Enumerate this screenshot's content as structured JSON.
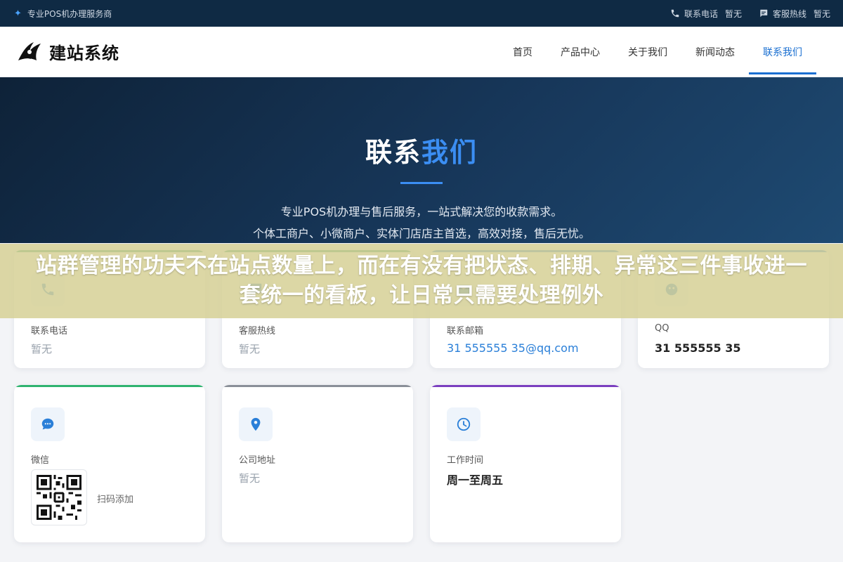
{
  "topbar": {
    "tagline": "专业POS机办理服务商",
    "phone_label": "联系电话",
    "phone_value": "暂无",
    "hotline_label": "客服热线",
    "hotline_value": "暂无"
  },
  "header": {
    "logo_text": "建站系统",
    "nav": [
      {
        "label": "首页",
        "active": false
      },
      {
        "label": "产品中心",
        "active": false
      },
      {
        "label": "关于我们",
        "active": false
      },
      {
        "label": "新闻动态",
        "active": false
      },
      {
        "label": "联系我们",
        "active": true
      }
    ]
  },
  "hero": {
    "title_plain": "联系",
    "title_highlight": "我们",
    "desc_line1": "专业POS机办理与售后服务，一站式解决您的收款需求。",
    "desc_line2": "个体工商户、小微商户、实体门店店主首选，高效对接，售后无忧。"
  },
  "cards": [
    {
      "label": "联系电话",
      "value": "暂无",
      "icon": "phone-icon",
      "accent": "#2f9e6a"
    },
    {
      "label": "客服热线",
      "value": "暂无",
      "icon": "chat-icon",
      "accent": "#2f9e6a"
    },
    {
      "label": "联系邮箱",
      "value": "31 555555 35@qq.com",
      "icon": "mail-icon",
      "accent": "#2a7fd8"
    },
    {
      "label": "QQ",
      "value": "31 555555 35",
      "icon": "qq-icon",
      "accent": "#2a7fd8"
    },
    {
      "label": "微信",
      "qr_text": "扫码添加",
      "icon": "wechat-icon",
      "accent": "#2fb36f"
    },
    {
      "label": "公司地址",
      "value": "暂无",
      "icon": "location-icon",
      "accent": "#8a8f98"
    },
    {
      "label": "工作时间",
      "value": "周一至周五",
      "icon": "clock-icon",
      "accent": "#7b3fbf"
    }
  ],
  "banner": {
    "text": "站群管理的功夫不在站点数量上，而在有没有把状态、排期、异常这三件事收进一套统一的看板，让日常只需要处理例外"
  }
}
